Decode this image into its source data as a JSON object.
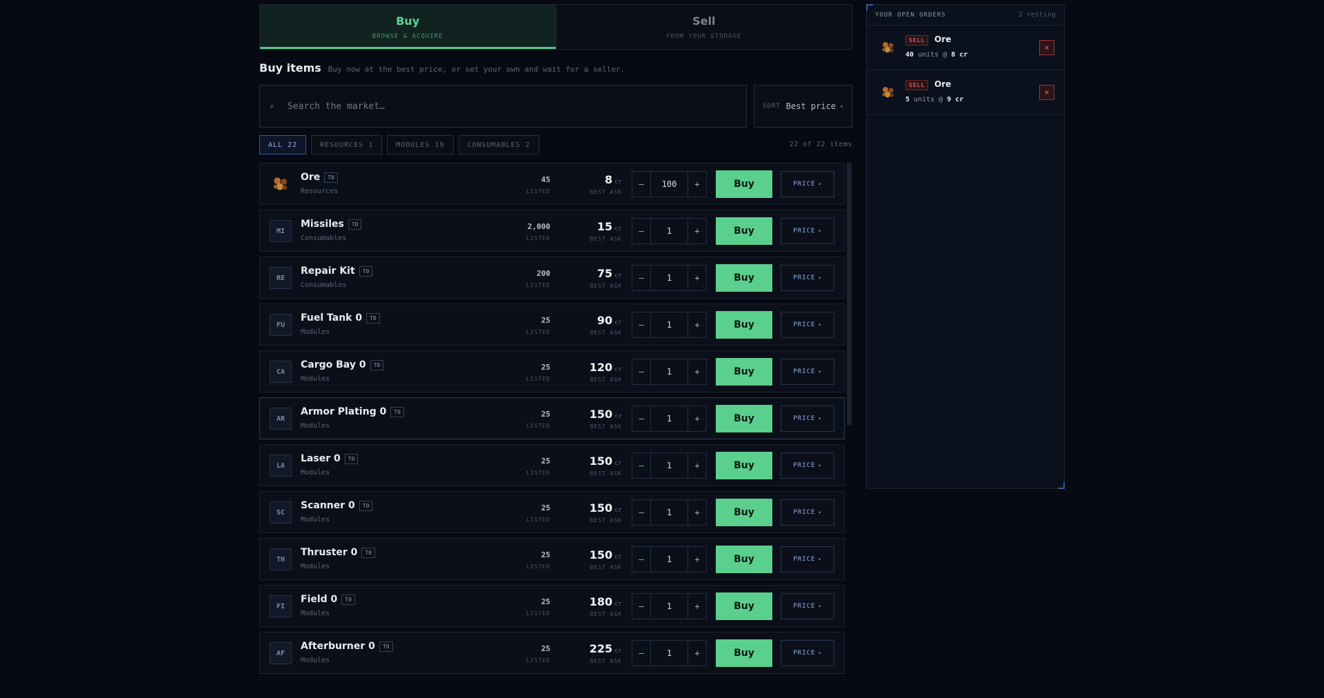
{
  "tabs": [
    {
      "title": "Buy",
      "subtitle": "BROWSE & ACQUIRE",
      "active": true
    },
    {
      "title": "Sell",
      "subtitle": "FROM YOUR STORAGE",
      "active": false
    }
  ],
  "heading": {
    "title": "Buy items",
    "subtitle": "Buy now at the best price, or set your own and wait for a seller."
  },
  "search": {
    "icon": "⌕",
    "placeholder": "Search the market…"
  },
  "sort": {
    "label": "SORT",
    "value": "Best price",
    "caret": "▾"
  },
  "filters": [
    {
      "label": "ALL 22",
      "active": true
    },
    {
      "label": "RESOURCES 1",
      "active": false
    },
    {
      "label": "MODULES 19",
      "active": false
    },
    {
      "label": "CONSUMABLES 2",
      "active": false
    }
  ],
  "count_text": "22 of 22 items",
  "columns": {
    "listed_label": "LISTED",
    "ask_label": "BEST ASK",
    "unit": "cr",
    "buy_label": "Buy",
    "price_label": "PRICE",
    "minus": "–",
    "plus": "+"
  },
  "items": [
    {
      "name": "Ore",
      "tag": "T0",
      "category": "Resources",
      "abbr": "",
      "icon": "ore-icon",
      "listed": "45",
      "ask": "8",
      "qty": "100"
    },
    {
      "name": "Missiles",
      "tag": "T0",
      "category": "Consumables",
      "abbr": "MI",
      "listed": "2,000",
      "ask": "15",
      "qty": "1"
    },
    {
      "name": "Repair Kit",
      "tag": "T0",
      "category": "Consumables",
      "abbr": "RE",
      "listed": "200",
      "ask": "75",
      "qty": "1"
    },
    {
      "name": "Fuel Tank 0",
      "tag": "T0",
      "category": "Modules",
      "abbr": "FU",
      "listed": "25",
      "ask": "90",
      "qty": "1"
    },
    {
      "name": "Cargo Bay 0",
      "tag": "T0",
      "category": "Modules",
      "abbr": "CA",
      "listed": "25",
      "ask": "120",
      "qty": "1"
    },
    {
      "name": "Armor Plating 0",
      "tag": "T0",
      "category": "Modules",
      "abbr": "AR",
      "listed": "25",
      "ask": "150",
      "qty": "1"
    },
    {
      "name": "Laser 0",
      "tag": "T0",
      "category": "Modules",
      "abbr": "LA",
      "listed": "25",
      "ask": "150",
      "qty": "1"
    },
    {
      "name": "Scanner 0",
      "tag": "T0",
      "category": "Modules",
      "abbr": "SC",
      "listed": "25",
      "ask": "150",
      "qty": "1"
    },
    {
      "name": "Thruster 0",
      "tag": "T0",
      "category": "Modules",
      "abbr": "TH",
      "listed": "25",
      "ask": "150",
      "qty": "1"
    },
    {
      "name": "Field 0",
      "tag": "T0",
      "category": "Modules",
      "abbr": "FI",
      "listed": "25",
      "ask": "180",
      "qty": "1"
    },
    {
      "name": "Afterburner 0",
      "tag": "T0",
      "category": "Modules",
      "abbr": "AF",
      "listed": "25",
      "ask": "225",
      "qty": "1"
    }
  ],
  "orders": {
    "title": "YOUR OPEN ORDERS",
    "count": "2 resting",
    "list": [
      {
        "side": "SELL",
        "name": "Ore",
        "units": "40",
        "units_label": "units @",
        "price": "8 cr",
        "icon": "ore-icon"
      },
      {
        "side": "SELL",
        "name": "Ore",
        "units": "5",
        "units_label": "units @",
        "price": "9 cr",
        "icon": "ore-icon"
      }
    ],
    "cancel": "×"
  },
  "colors": {
    "accent_buy": "#5bcf8d",
    "accent_blue": "#8fb1ea",
    "sell_red": "#e05a5f",
    "background": "#070a12"
  }
}
